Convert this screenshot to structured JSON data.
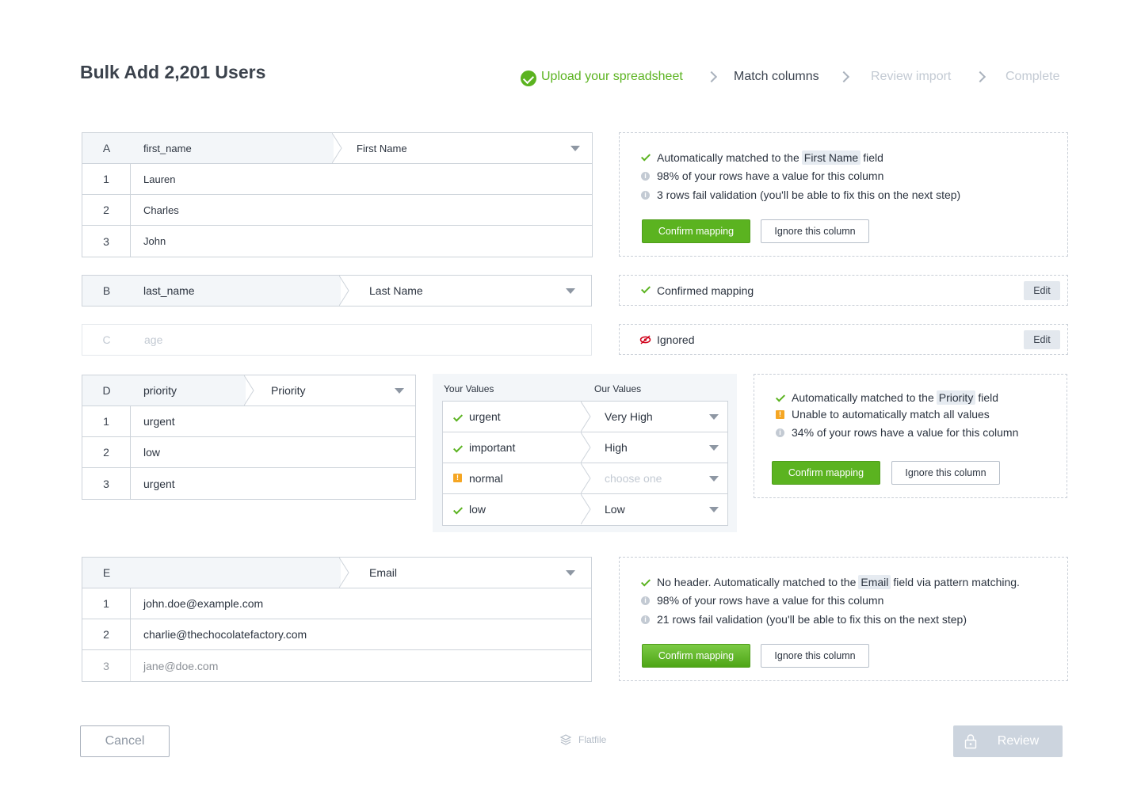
{
  "page_title": "Bulk Add 2,201 Users",
  "steps": [
    {
      "label": "Upload your spreadsheet",
      "state": "done"
    },
    {
      "label": "Match columns",
      "state": "active"
    },
    {
      "label": "Review import",
      "state": "future"
    },
    {
      "label": "Complete",
      "state": "future"
    }
  ],
  "columns": {
    "a": {
      "letter": "A",
      "header": "first_name",
      "selected": "First Name",
      "rows": [
        {
          "n": "1",
          "v": "Lauren"
        },
        {
          "n": "2",
          "v": "Charles"
        },
        {
          "n": "3",
          "v": "John"
        }
      ],
      "panel": {
        "line1_pre": "Automatically matched to the",
        "field": "First Name",
        "line1_post": "field",
        "line2": "98% of your rows have a value for this column",
        "line3": "3 rows fail validation (you'll be able to fix this on the next step)",
        "confirm": "Confirm mapping",
        "ignore": "Ignore this column"
      }
    },
    "b": {
      "letter": "B",
      "header": "last_name",
      "selected": "Last Name",
      "status": "Confirmed mapping",
      "edit": "Edit"
    },
    "c": {
      "letter": "C",
      "header": "age",
      "status": "Ignored",
      "edit": "Edit"
    },
    "d": {
      "letter": "D",
      "header": "priority",
      "selected": "Priority",
      "rows": [
        {
          "n": "1",
          "v": "urgent"
        },
        {
          "n": "2",
          "v": "low"
        },
        {
          "n": "3",
          "v": "urgent"
        }
      ],
      "value_map": {
        "your_values_label": "Your Values",
        "our_values_label": "Our Values",
        "rows": [
          {
            "yours": "urgent",
            "ours": "Very High",
            "status": "matched"
          },
          {
            "yours": "important",
            "ours": "High",
            "status": "matched"
          },
          {
            "yours": "normal",
            "ours": "choose one",
            "status": "unmatched"
          },
          {
            "yours": "low",
            "ours": "Low",
            "status": "matched"
          }
        ]
      },
      "panel": {
        "line1_pre": "Automatically matched to the",
        "field": "Priority",
        "line1_post": "field",
        "line2": "Unable to automatically match all values",
        "line3": "34% of your rows have a value for this column",
        "confirm": "Confirm mapping",
        "ignore": "Ignore this column"
      }
    },
    "e": {
      "letter": "E",
      "header": "",
      "selected": "Email",
      "rows": [
        {
          "n": "1",
          "v": "john.doe@example.com"
        },
        {
          "n": "2",
          "v": "charlie@thechocolatefactory.com"
        },
        {
          "n": "3",
          "v": "jane@doe.com"
        }
      ],
      "panel": {
        "line1_pre": "No header. Automatically matched to the",
        "field": "Email",
        "line1_post": "field via pattern matching.",
        "line2": "98% of your rows have a value for this column",
        "line3": "21 rows fail validation (you'll be able to fix this on the next step)",
        "confirm": "Confirm mapping",
        "ignore": "Ignore this column"
      }
    }
  },
  "footer": {
    "cancel": "Cancel",
    "brand": "Flatfile",
    "review": "Review"
  },
  "colors": {
    "accent_green": "#5bb320",
    "warning": "#f5a623",
    "ignored_red": "#d0021b",
    "muted": "#c3cad3"
  }
}
